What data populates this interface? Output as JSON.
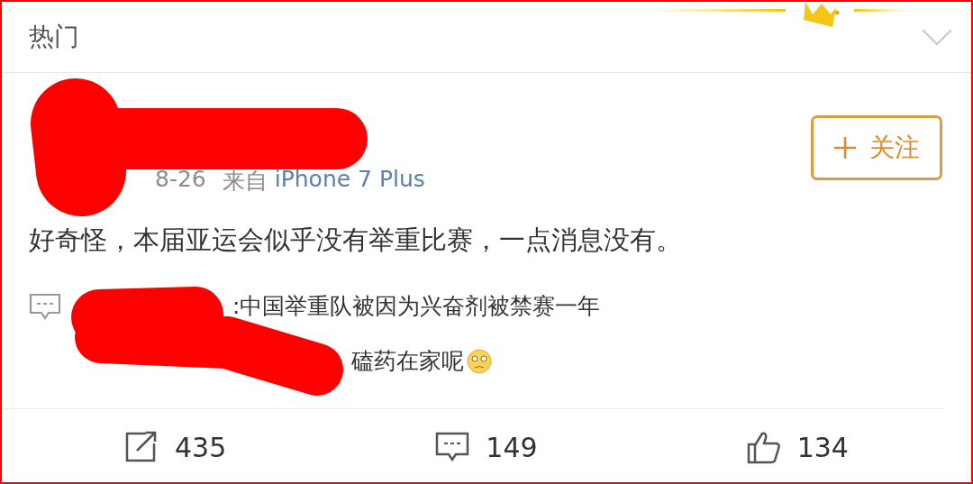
{
  "header": {
    "title": "热门"
  },
  "post": {
    "date": "8-26",
    "source_prefix": "来自",
    "source": "iPhone 7 Plus",
    "follow_label": "关注",
    "text": "好奇怪，本届亚运会似乎没有举重比赛，一点消息没有。",
    "comment_lines": [
      ":中国举重队被因为兴奋剂被禁赛一年",
      "磕药在家呢"
    ]
  },
  "actions": [
    {
      "kind": "repost",
      "count": "435"
    },
    {
      "kind": "comment",
      "count": "149"
    },
    {
      "kind": "like",
      "count": "134"
    }
  ]
}
